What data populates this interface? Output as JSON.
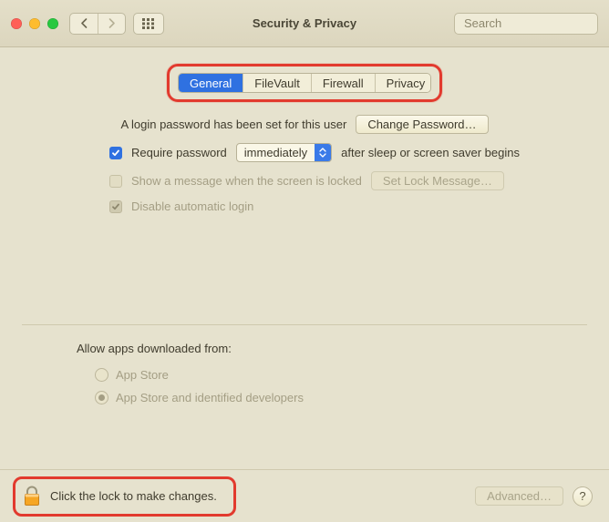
{
  "window": {
    "title": "Security & Privacy"
  },
  "toolbar": {
    "search_placeholder": "Search"
  },
  "tabs": [
    {
      "label": "General",
      "active": true
    },
    {
      "label": "FileVault",
      "active": false
    },
    {
      "label": "Firewall",
      "active": false
    },
    {
      "label": "Privacy",
      "active": false
    }
  ],
  "general": {
    "login_password_text": "A login password has been set for this user",
    "change_password_label": "Change Password…",
    "require_password_label": "Require password",
    "require_password_checked": true,
    "require_password_select": "immediately",
    "require_password_after": "after sleep or screen saver begins",
    "show_message_label": "Show a message when the screen is locked",
    "show_message_checked": false,
    "set_lock_message_label": "Set Lock Message…",
    "disable_auto_login_label": "Disable automatic login",
    "disable_auto_login_checked": true
  },
  "downloads": {
    "header": "Allow apps downloaded from:",
    "options": [
      {
        "label": "App Store",
        "selected": false
      },
      {
        "label": "App Store and identified developers",
        "selected": true
      }
    ]
  },
  "footer": {
    "lock_text": "Click the lock to make changes.",
    "advanced_label": "Advanced…",
    "help_label": "?"
  }
}
